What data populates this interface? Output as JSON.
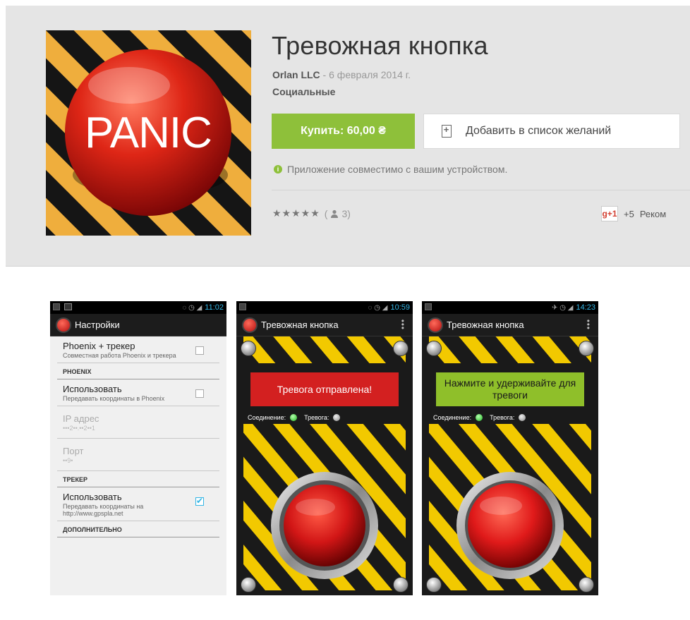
{
  "app": {
    "title": "Тревожная кнопка",
    "developer": "Orlan LLC",
    "date_separator": " - ",
    "date": "6 февраля 2014 г.",
    "category": "Социальные",
    "icon_label": "PANIC",
    "buy_label": "Купить: 60,00 ₴",
    "wishlist_label": "Добавить в список желаний",
    "compat_text": "Приложение совместимо с вашим устройством.",
    "rating_stars": "★★★★★",
    "rating_count_open": "(",
    "rating_count": "3",
    "rating_count_close": ")",
    "gplus_label": "g+1",
    "gplus_count": "+5",
    "gplus_reco": "Реком"
  },
  "colors": {
    "header_bg": "#e5e5e5",
    "buy_green": "#8ec03a",
    "status_blue": "#33b5e5",
    "alarm_red": "#d32020",
    "hint_green": "#8fbf2a",
    "stripe_yellow": "#f2c900"
  },
  "screenshots": {
    "s1": {
      "time": "11:02",
      "title": "Настройки",
      "items": [
        {
          "title": "Phoenix + трекер",
          "sub": "Совместная работа Phoenix и трекера"
        },
        {
          "header": "PHOENIX"
        },
        {
          "title": "Использовать",
          "sub": "Передавать координаты в Phoenix"
        },
        {
          "title": "IP адрес",
          "sub": "•••2••.••2••1"
        },
        {
          "title": "Порт",
          "sub": "••9•"
        },
        {
          "header": "ТРЕКЕР"
        },
        {
          "title": "Использовать",
          "sub": "Передавать координаты на http://www.gpspla.net"
        },
        {
          "header": "ДОПОЛНИТЕЛЬНО"
        }
      ]
    },
    "s2": {
      "time": "10:59",
      "title": "Тревожная кнопка",
      "message": "Тревога отправлена!",
      "conn_label": "Соединение:",
      "alarm_label": "Тревога:"
    },
    "s3": {
      "time": "14:23",
      "title": "Тревожная кнопка",
      "message": "Нажмите и удерживайте для тревоги",
      "conn_label": "Соединение:",
      "alarm_label": "Тревога:"
    }
  }
}
